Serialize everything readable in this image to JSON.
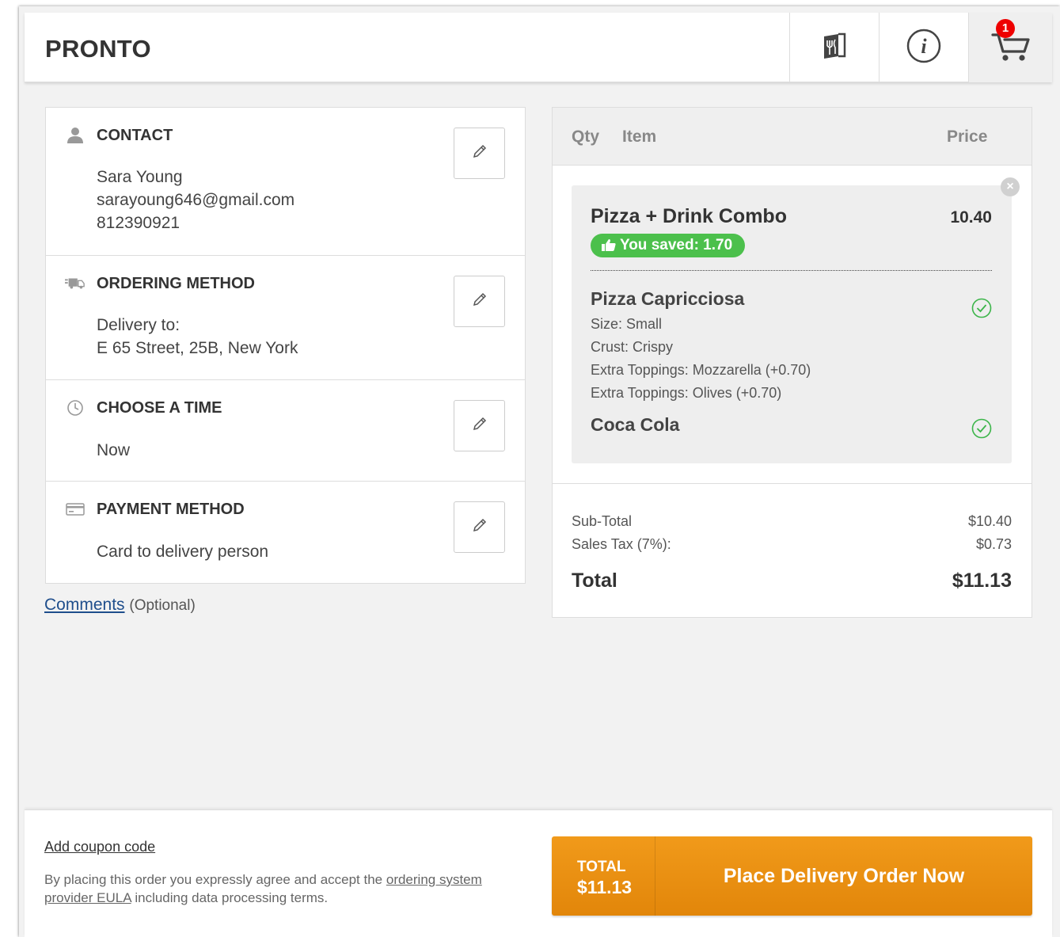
{
  "header": {
    "brand": "PRONTO",
    "cart_count": "1"
  },
  "sections": {
    "contact": {
      "title": "CONTACT",
      "name": "Sara Young",
      "email": "sarayoung646@gmail.com",
      "phone": "812390921"
    },
    "ordering": {
      "title": "ORDERING METHOD",
      "line1": "Delivery to:",
      "line2": "E 65 Street, 25B, New York"
    },
    "time": {
      "title": "CHOOSE A TIME",
      "value": "Now"
    },
    "payment": {
      "title": "PAYMENT METHOD",
      "value": "Card to delivery person"
    }
  },
  "comments": {
    "link": "Comments",
    "optional": "(Optional)"
  },
  "cart": {
    "col_qty": "Qty",
    "col_item": "Item",
    "col_price": "Price",
    "item": {
      "name": "Pizza + Drink Combo",
      "price": "10.40",
      "saved": "You saved: 1.70",
      "sub1": {
        "name": "Pizza Capricciosa",
        "options": [
          "Size: Small",
          "Crust: Crispy",
          "Extra Toppings: Mozzarella (+0.70)",
          "Extra Toppings: Olives (+0.70)"
        ]
      },
      "sub2": {
        "name": "Coca Cola"
      }
    },
    "subtotal_label": "Sub-Total",
    "subtotal_value": "$10.40",
    "tax_label": "Sales Tax (7%):",
    "tax_value": "$0.73",
    "total_label": "Total",
    "total_value": "$11.13"
  },
  "footer": {
    "coupon": "Add coupon code",
    "eula_pre": "By placing this order you expressly agree and accept the ",
    "eula_link": "ordering system provider EULA",
    "eula_post": " including data processing terms.",
    "total_label": "TOTAL",
    "total_value": "$11.13",
    "order_button": "Place Delivery Order Now"
  },
  "colors": {
    "accent_orange": "#ef9514",
    "saved_green": "#4cc04c",
    "badge_red": "#ee0000",
    "link_blue": "#1f4e8c"
  }
}
